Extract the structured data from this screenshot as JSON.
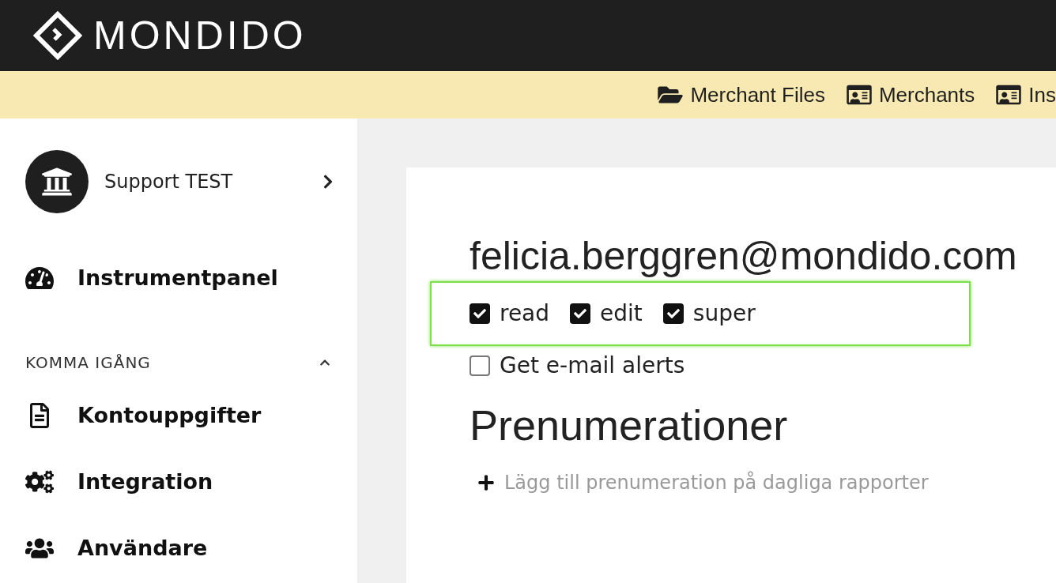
{
  "brand": {
    "name": "MONDIDO"
  },
  "top_nav": [
    {
      "kind": "folder",
      "label": "Merchant Files"
    },
    {
      "kind": "card",
      "label": "Merchants"
    },
    {
      "kind": "card",
      "label": "Ins"
    }
  ],
  "account": {
    "name": "Support TEST"
  },
  "sidebar": {
    "top_items": [
      {
        "kind": "dashboard",
        "label": "Instrumentpanel"
      }
    ],
    "section": {
      "title": "KOMMA IGÅNG",
      "expanded": true,
      "items": [
        {
          "kind": "document",
          "label": "Kontouppgifter"
        },
        {
          "kind": "gears",
          "label": "Integration"
        },
        {
          "kind": "users",
          "label": "Användare"
        }
      ]
    }
  },
  "user": {
    "email": "felicia.berggren@mondido.com",
    "permissions": [
      {
        "label": "read",
        "checked": true
      },
      {
        "label": "edit",
        "checked": true
      },
      {
        "label": "super",
        "checked": true
      }
    ],
    "alerts": {
      "label": "Get e-mail alerts",
      "checked": false
    }
  },
  "subscriptions": {
    "title": "Prenumerationer",
    "add_link": "Lägg till prenumeration på dagliga rapporter"
  }
}
